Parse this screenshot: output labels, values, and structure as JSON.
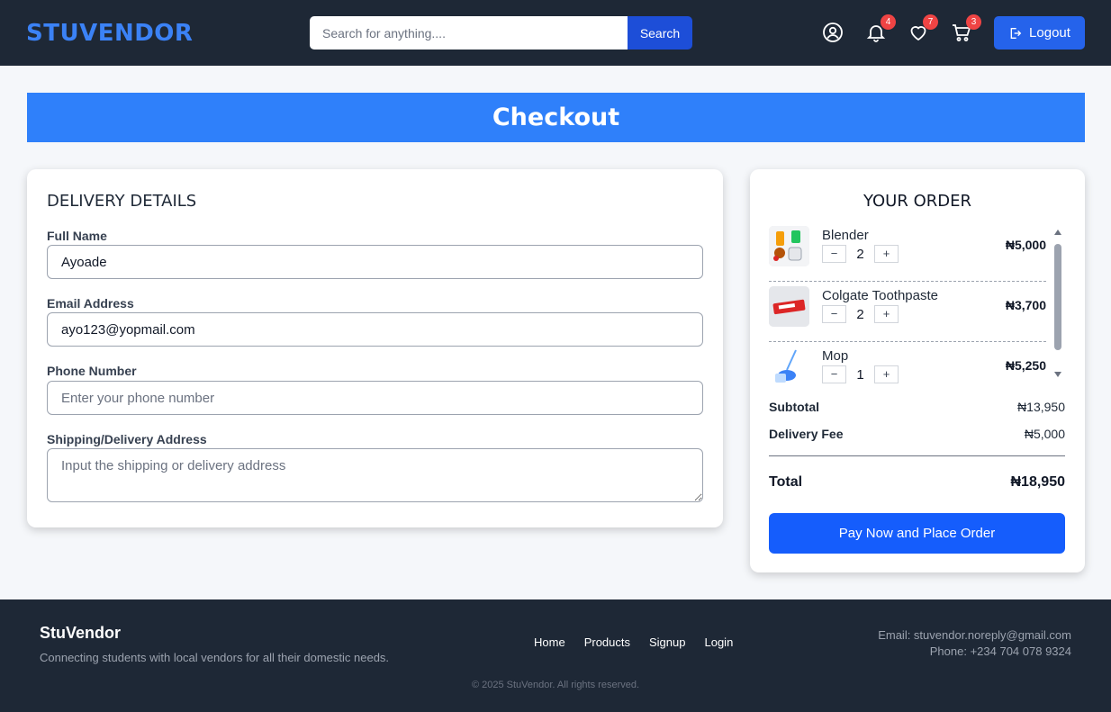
{
  "header": {
    "logo": "STUVENDOR",
    "search": {
      "placeholder": "Search for anything....",
      "button_label": "Search"
    },
    "icons": [
      {
        "name": "user-icon",
        "badge": ""
      },
      {
        "name": "bell-icon",
        "badge": "4"
      },
      {
        "name": "heart-icon",
        "badge": "7"
      },
      {
        "name": "cart-icon",
        "badge": "3"
      }
    ],
    "logout_label": "Logout"
  },
  "banner": {
    "title": "Checkout"
  },
  "delivery": {
    "title": "DELIVERY DETAILS",
    "fields": [
      {
        "label": "Full Name",
        "value": "Ayoade",
        "placeholder": ""
      },
      {
        "label": "Email Address",
        "value": "ayo123@yopmail.com",
        "placeholder": ""
      },
      {
        "label": "Phone Number",
        "value": "",
        "placeholder": "Enter your phone number"
      },
      {
        "label": "Shipping/Delivery Address",
        "value": "",
        "placeholder": "Input the shipping or delivery address"
      }
    ]
  },
  "order": {
    "title": "YOUR ORDER",
    "items": [
      {
        "name": "Blender",
        "qty": "2",
        "price": "₦5,000",
        "thumb": "blender-image"
      },
      {
        "name": "Colgate Toothpaste",
        "qty": "2",
        "price": "₦3,700",
        "thumb": "toothpaste-image"
      },
      {
        "name": "Mop",
        "qty": "1",
        "price": "₦5,250",
        "thumb": "mop-image"
      }
    ],
    "qty_minus": "−",
    "qty_plus": "+",
    "subtotal_label": "Subtotal",
    "subtotal_value": "₦13,950",
    "delivery_label": "Delivery Fee",
    "delivery_value": "₦5,000",
    "total_label": "Total",
    "total_value": "₦18,950",
    "pay_label": "Pay Now and Place Order"
  },
  "footer": {
    "brand": "StuVendor",
    "tagline": "Connecting students with local vendors for all their domestic needs.",
    "links": [
      "Home",
      "Products",
      "Signup",
      "Login"
    ],
    "email": "Email: stuvendor.noreply@gmail.com",
    "phone": "Phone: +234 704 078 9324",
    "copyright": "© 2025 StuVendor. All rights reserved."
  }
}
